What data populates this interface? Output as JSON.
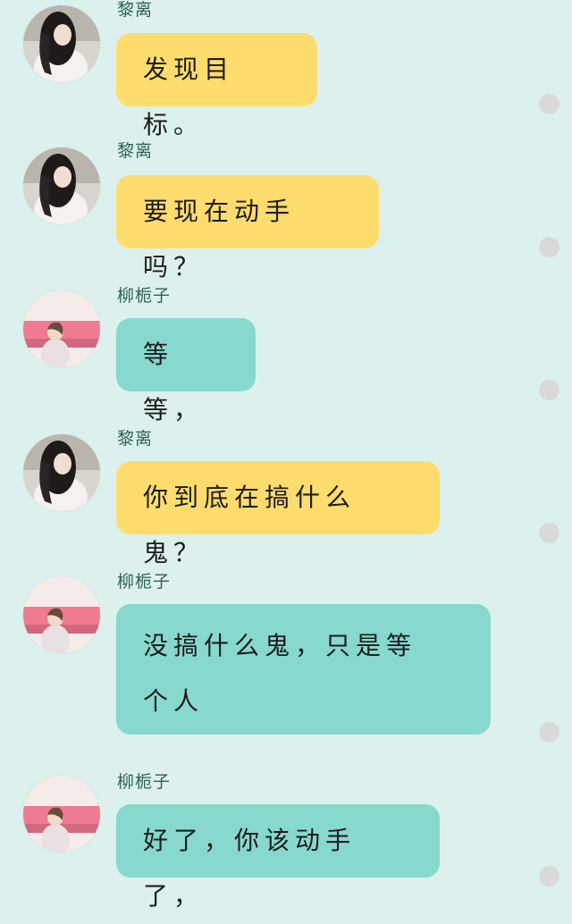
{
  "messages": [
    {
      "sender": "黎离",
      "text": "发现目标。",
      "avatar": "avatar-dark-hair",
      "color": "yellow"
    },
    {
      "sender": "黎离",
      "text": "要现在动手吗？",
      "avatar": "avatar-dark-hair",
      "color": "yellow"
    },
    {
      "sender": "柳栀子",
      "text": "等等，",
      "avatar": "avatar-pink-background",
      "color": "teal"
    },
    {
      "sender": "黎离",
      "text": "你到底在搞什么鬼？",
      "avatar": "avatar-dark-hair",
      "color": "yellow"
    },
    {
      "sender": "柳栀子",
      "text": "没搞什么鬼，只是等个人",
      "avatar": "avatar-pink-background",
      "color": "teal"
    },
    {
      "sender": "柳栀子",
      "text": "好了，你该动手了，",
      "avatar": "avatar-pink-background",
      "color": "teal"
    }
  ],
  "colors": {
    "background": "#dcf1ed",
    "yellow_bubble": "#ffdc6e",
    "teal_bubble": "#88d9cd",
    "sender_text": "#2f5f57",
    "status_dot": "#d9d9d9"
  }
}
